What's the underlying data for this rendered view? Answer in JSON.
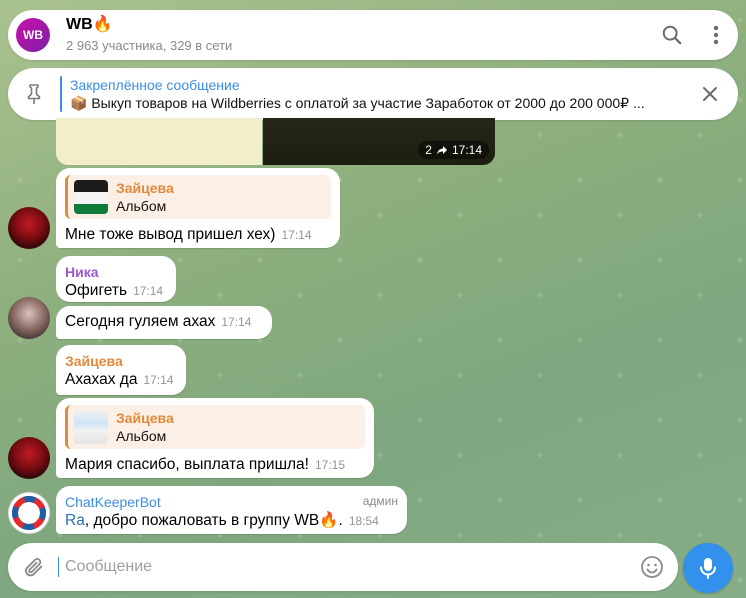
{
  "header": {
    "avatar_text": "WB",
    "title": "WB🔥",
    "subtitle": "2 963 участника, 329 в сети"
  },
  "pinned": {
    "title": "Закреплённое сообщение",
    "text": "📦 Выкуп товаров на Wildberries с оплатой за участие Заработок от 2000 до 200 000₽ ..."
  },
  "media": {
    "views": "2",
    "time": "17:14"
  },
  "messages": [
    {
      "reply_name": "Зайцева",
      "reply_text": "Альбом",
      "text": "Мне тоже вывод пришел хех)",
      "time": "17:14"
    },
    {
      "sender": "Ника",
      "text": "Офигеть",
      "time": "17:14"
    },
    {
      "text": "Сегодня гуляем ахах",
      "time": "17:14"
    },
    {
      "sender": "Зайцева",
      "text": "Ахахах да",
      "time": "17:14"
    },
    {
      "reply_name": "Зайцева",
      "reply_text": "Альбом",
      "text": "Мария спасибо, выплата пришла!",
      "time": "17:15"
    },
    {
      "sender": "ChatKeeperBot",
      "badge": "админ",
      "mention": "Ra",
      "text": ", добро пожаловать в группу WB🔥.",
      "time": "18:54"
    }
  ],
  "composer": {
    "placeholder": "Сообщение"
  },
  "colors": {
    "accent": "#3390ec",
    "sender_nika": "#9b59d0",
    "sender_zaitseva": "#e28a3c",
    "sender_bot": "#3a8ee6"
  }
}
